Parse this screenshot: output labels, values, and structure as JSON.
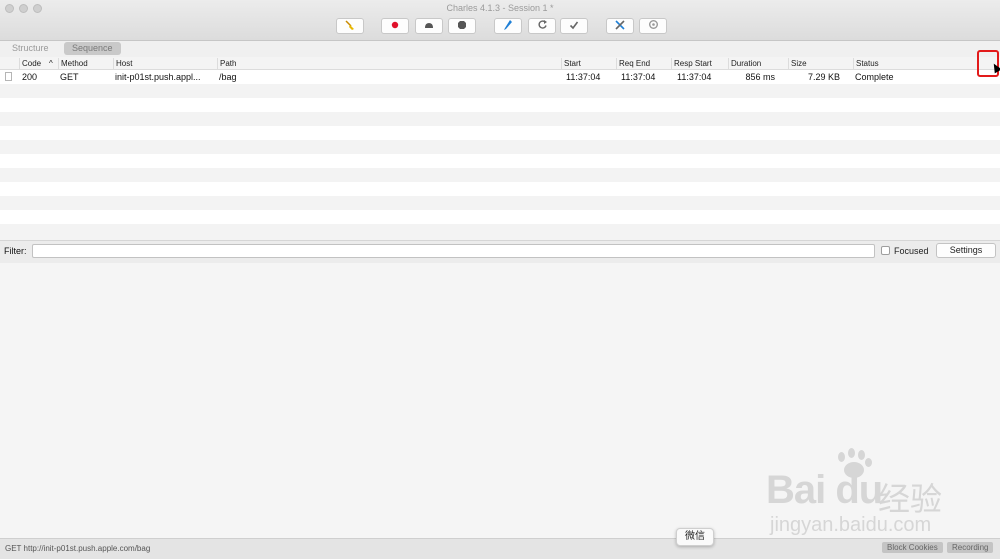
{
  "window": {
    "title": "Charles 4.1.3 - Session 1 *"
  },
  "toolbar": {
    "icons": [
      "broom-icon",
      "record-icon",
      "throttle-icon",
      "breakpoint-icon",
      "compose-icon",
      "repeat-icon",
      "validate-icon",
      "tools-icon",
      "settings-icon"
    ],
    "glyphs": [
      "🧹",
      "●",
      "☁",
      "⬣",
      "✎",
      "↻",
      "✓",
      "✂",
      "⚙"
    ]
  },
  "tabs": [
    {
      "label": "Structure",
      "active": false
    },
    {
      "label": "Sequence",
      "active": true
    }
  ],
  "table": {
    "columns": [
      "Code",
      "Method",
      "Host",
      "Path",
      "Start",
      "Req End",
      "Resp Start",
      "Duration",
      "Size",
      "Status"
    ],
    "sort_indicator": "^",
    "rows": [
      {
        "code": "200",
        "method": "GET",
        "host": "init-p01st.push.appl...",
        "path": "/bag",
        "start": "11:37:04",
        "req_end": "11:37:04",
        "resp_start": "11:37:04",
        "duration": "856 ms",
        "size": "7.29 KB",
        "status": "Complete"
      }
    ]
  },
  "filter": {
    "label": "Filter:",
    "value": "",
    "focused_label": "Focused",
    "focused_checked": false,
    "settings_label": "Settings"
  },
  "status_bar": {
    "text": "GET http://init-p01st.push.apple.com/bag",
    "block_cookies": "Block Cookies",
    "recording": "Recording"
  },
  "tooltip": {
    "text": "微信"
  },
  "watermark": {
    "logo": "Bai du",
    "brand_cn": "经验",
    "url": "jingyan.baidu.com"
  },
  "colors": {
    "highlight": "#e21a1a",
    "record": "#e0102a",
    "compose": "#1e7fd6",
    "broom": "#e8b800"
  }
}
